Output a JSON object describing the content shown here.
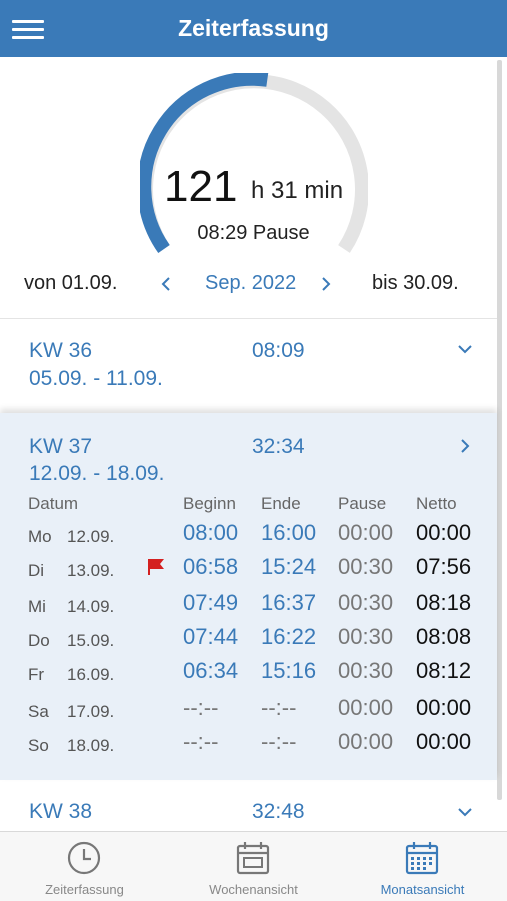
{
  "header": {
    "title": "Zeiterfassung",
    "menu_icon": "menu-icon"
  },
  "summary": {
    "hours": "121",
    "hours_rest": "h 31 min",
    "pause": "08:29 Pause",
    "progress_fraction": 0.62,
    "colors": {
      "accent": "#3a7ab8",
      "track": "#e4e4e4"
    }
  },
  "period": {
    "from": "von 01.09.",
    "month": "Sep. 2022",
    "to": "bis 30.09.",
    "prev_icon": "chevron-left-icon",
    "next_icon": "chevron-right-icon"
  },
  "weeks": [
    {
      "label": "KW 36",
      "range": "05.09. - 11.09.",
      "total": "08:09",
      "toggle_icon": "chevron-down-icon"
    },
    {
      "label": "KW 37",
      "range": "12.09. - 18.09.",
      "total": "32:34",
      "toggle_icon": "chevron-right-icon"
    },
    {
      "label": "KW 38",
      "total": "32:48",
      "toggle_icon": "chevron-down-icon"
    }
  ],
  "table": {
    "headers": [
      "Datum",
      "Beginn",
      "Ende",
      "Pause",
      "Netto"
    ],
    "rows": [
      {
        "weekday": "Mo",
        "date": "12.09.",
        "begin": "08:00",
        "end": "16:00",
        "pause": "00:00",
        "net": "00:00",
        "flag": false
      },
      {
        "weekday": "Di",
        "date": "13.09.",
        "begin": "06:58",
        "end": "15:24",
        "pause": "00:30",
        "net": "07:56",
        "flag": true
      },
      {
        "weekday": "Mi",
        "date": "14.09.",
        "begin": "07:49",
        "end": "16:37",
        "pause": "00:30",
        "net": "08:18",
        "flag": false
      },
      {
        "weekday": "Do",
        "date": "15.09.",
        "begin": "07:44",
        "end": "16:22",
        "pause": "00:30",
        "net": "08:08",
        "flag": false
      },
      {
        "weekday": "Fr",
        "date": "16.09.",
        "begin": "06:34",
        "end": "15:16",
        "pause": "00:30",
        "net": "08:12",
        "flag": false
      },
      {
        "weekday": "Sa",
        "date": "17.09.",
        "begin": "--:--",
        "end": "--:--",
        "pause": "00:00",
        "net": "00:00",
        "flag": false
      },
      {
        "weekday": "So",
        "date": "18.09.",
        "begin": "--:--",
        "end": "--:--",
        "pause": "00:00",
        "net": "00:00",
        "flag": false
      }
    ]
  },
  "bottom_nav": [
    {
      "label": "Zeiterfassung",
      "icon": "clock-icon",
      "active": false
    },
    {
      "label": "Wochenansicht",
      "icon": "calendar-week-icon",
      "active": false
    },
    {
      "label": "Monatsansicht",
      "icon": "calendar-month-icon",
      "active": true
    }
  ]
}
